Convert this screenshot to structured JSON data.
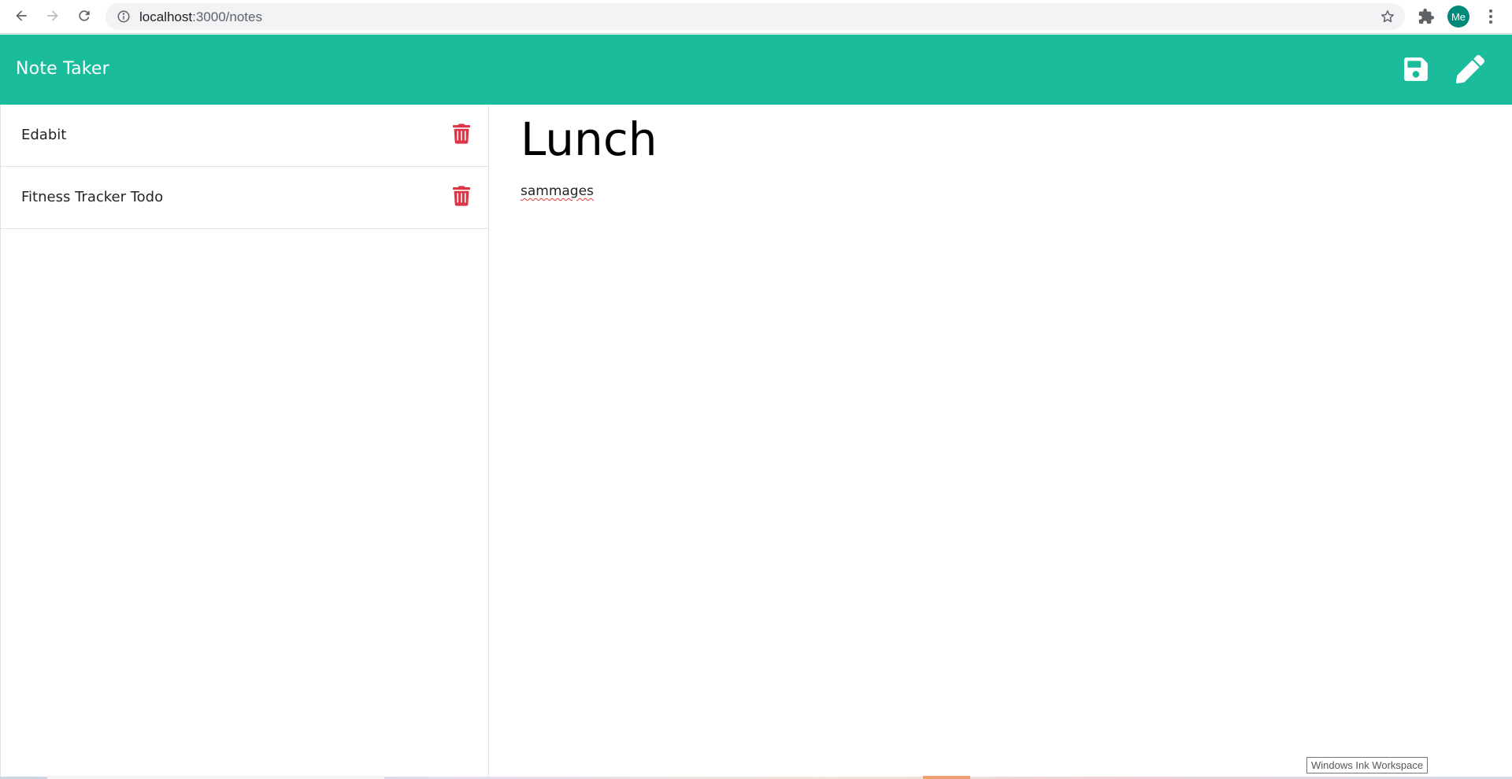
{
  "browser": {
    "url_host": "localhost",
    "url_rest": ":3000/notes",
    "avatar_initials": "Me"
  },
  "app": {
    "title": "Note Taker",
    "accent_color": "#1abc9c",
    "delete_color": "#dc3545"
  },
  "notes": [
    {
      "title": "Edabit"
    },
    {
      "title": "Fitness Tracker Todo"
    }
  ],
  "active_note": {
    "title": "Lunch",
    "text": "sammages"
  },
  "tooltip": {
    "text": "Windows Ink Workspace"
  },
  "icons": {
    "back": "arrow-left-icon",
    "forward": "arrow-right-icon",
    "reload": "reload-icon",
    "info": "info-icon",
    "bookmark": "star-icon",
    "extensions": "puzzle-icon",
    "menu": "kebab-menu-icon",
    "save": "floppy-disk-icon",
    "edit": "pencil-icon",
    "delete": "trash-icon"
  }
}
